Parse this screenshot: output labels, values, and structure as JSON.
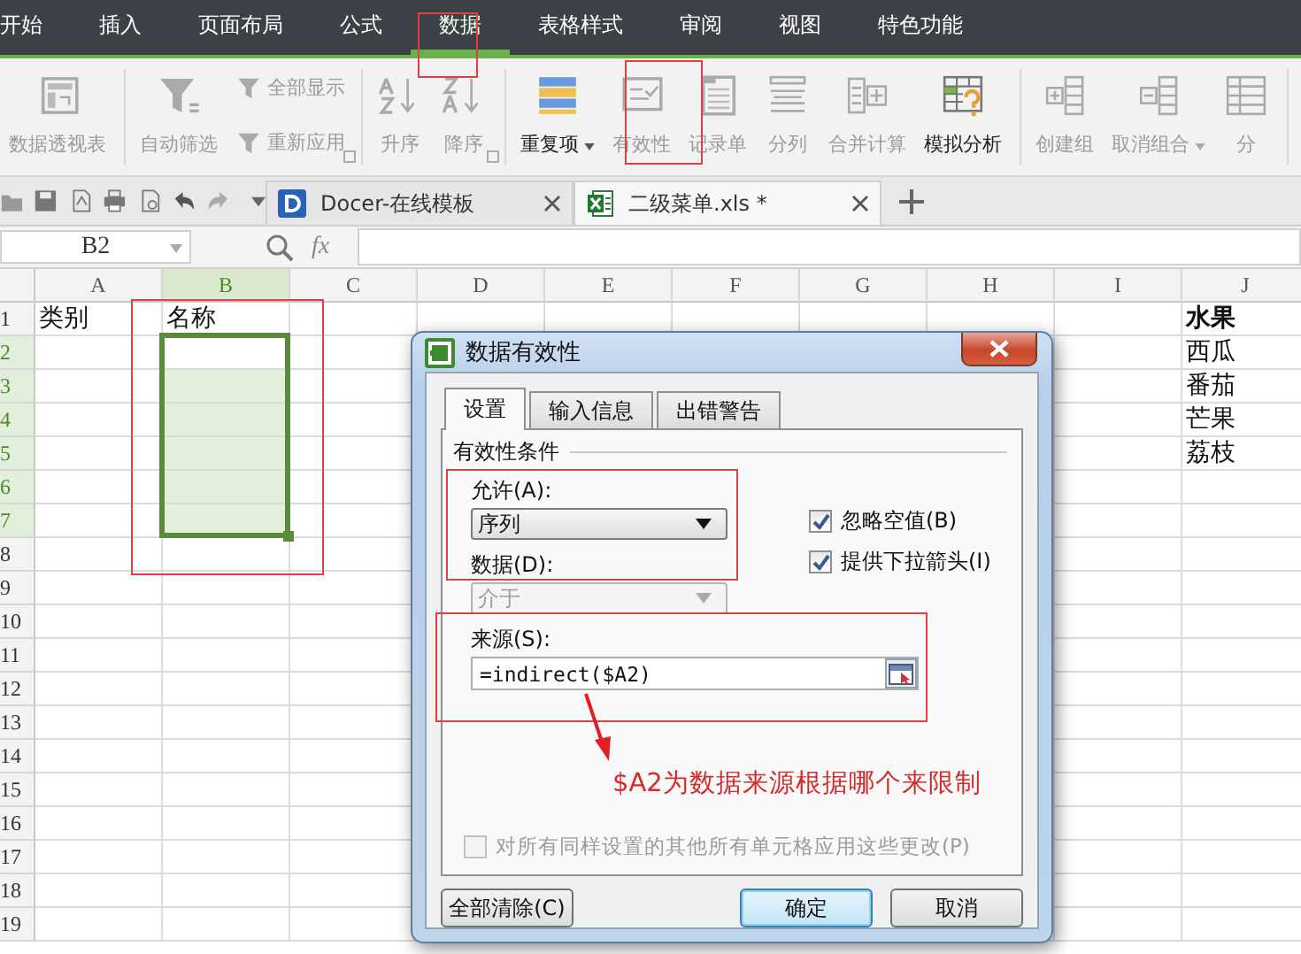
{
  "menu_tabs": [
    {
      "label": "开始",
      "selected": false
    },
    {
      "label": "插入",
      "selected": false
    },
    {
      "label": "页面布局",
      "selected": false
    },
    {
      "label": "公式",
      "selected": false
    },
    {
      "label": "数据",
      "selected": true
    },
    {
      "label": "表格样式",
      "selected": false
    },
    {
      "label": "审阅",
      "selected": false
    },
    {
      "label": "视图",
      "selected": false
    },
    {
      "label": "特色功能",
      "selected": false
    }
  ],
  "ribbon_groups": [
    {
      "launcher": false,
      "items": [
        {
          "kind": "large",
          "label": "数据透视表",
          "disabled": true,
          "dropdown": false
        }
      ]
    },
    {
      "launcher": true,
      "items": [
        {
          "kind": "large",
          "label": "自动筛选",
          "disabled": true,
          "dropdown": false
        },
        {
          "kind": "small",
          "label": "全部显示",
          "disabled": true,
          "dropdown": false
        },
        {
          "kind": "small",
          "label": "重新应用",
          "disabled": true,
          "dropdown": false
        }
      ]
    },
    {
      "launcher": true,
      "items": [
        {
          "kind": "large",
          "label": "升序",
          "disabled": true,
          "dropdown": false
        },
        {
          "kind": "large",
          "label": "降序",
          "disabled": true,
          "dropdown": false
        }
      ]
    },
    {
      "launcher": false,
      "items": [
        {
          "kind": "large",
          "label": "重复项",
          "disabled": false,
          "dropdown": true
        },
        {
          "kind": "large",
          "label": "有效性",
          "disabled": true,
          "dropdown": false
        },
        {
          "kind": "large",
          "label": "记录单",
          "disabled": true,
          "dropdown": false
        },
        {
          "kind": "large",
          "label": "分列",
          "disabled": true,
          "dropdown": false
        },
        {
          "kind": "large",
          "label": "合并计算",
          "disabled": true,
          "dropdown": false
        },
        {
          "kind": "large",
          "label": "模拟分析",
          "disabled": false,
          "dropdown": false
        }
      ]
    },
    {
      "launcher": false,
      "items": [
        {
          "kind": "large",
          "label": "创建组",
          "disabled": true,
          "dropdown": false
        },
        {
          "kind": "large",
          "label": "取消组合",
          "disabled": true,
          "dropdown": true
        },
        {
          "kind": "large",
          "label": "分",
          "disabled": true,
          "dropdown": false
        }
      ]
    }
  ],
  "doc_tabs": [
    {
      "kind": "docer",
      "label": "Docer-在线模板",
      "selected": false
    },
    {
      "kind": "sheet",
      "label": "二级菜单.xls *",
      "selected": true
    }
  ],
  "name_box": "B2",
  "formula_label": "fx",
  "sheet": {
    "columns": [
      {
        "label": "A",
        "selected": false
      },
      {
        "label": "B",
        "selected": true
      },
      {
        "label": "C",
        "selected": false
      },
      {
        "label": "D",
        "selected": false
      },
      {
        "label": "E",
        "selected": false
      },
      {
        "label": "F",
        "selected": false
      },
      {
        "label": "G",
        "selected": false
      },
      {
        "label": "H",
        "selected": false
      },
      {
        "label": "I",
        "selected": false
      },
      {
        "label": "J",
        "selected": false
      }
    ],
    "rows": [
      {
        "label": "1",
        "selected": false,
        "cells": {
          "A": {
            "text": "类别",
            "bold": false
          },
          "B": {
            "text": "名称",
            "bold": false
          },
          "J": {
            "text": "水果",
            "bold": true
          }
        }
      },
      {
        "label": "2",
        "selected": true,
        "cells": {
          "J": {
            "text": "西瓜",
            "bold": false
          }
        }
      },
      {
        "label": "3",
        "selected": true,
        "cells": {
          "J": {
            "text": "番茄",
            "bold": false
          }
        }
      },
      {
        "label": "4",
        "selected": true,
        "cells": {
          "J": {
            "text": "芒果",
            "bold": false
          }
        }
      },
      {
        "label": "5",
        "selected": true,
        "cells": {
          "J": {
            "text": "荔枝",
            "bold": false
          }
        }
      },
      {
        "label": "6",
        "selected": true
      },
      {
        "label": "7",
        "selected": true
      },
      {
        "label": "8",
        "selected": false
      },
      {
        "label": "9",
        "selected": false
      },
      {
        "label": "10",
        "selected": false
      },
      {
        "label": "11",
        "selected": false
      },
      {
        "label": "12",
        "selected": false
      },
      {
        "label": "13",
        "selected": false
      },
      {
        "label": "14",
        "selected": false
      },
      {
        "label": "15",
        "selected": false
      },
      {
        "label": "16",
        "selected": false
      },
      {
        "label": "17",
        "selected": false
      },
      {
        "label": "18",
        "selected": false
      },
      {
        "label": "19",
        "selected": false
      }
    ]
  },
  "dialog": {
    "title": "数据有效性",
    "tabs": [
      {
        "label": "设置",
        "selected": true
      },
      {
        "label": "输入信息",
        "selected": false
      },
      {
        "label": "出错警告",
        "selected": false
      }
    ],
    "group_title": "有效性条件",
    "allow": {
      "label": "允许(A):",
      "value": "序列",
      "disabled": false
    },
    "data": {
      "label": "数据(D):",
      "value": "介于",
      "disabled": true
    },
    "checkboxes": [
      {
        "label": "忽略空值(B)",
        "checked": true,
        "disabled": false
      },
      {
        "label": "提供下拉箭头(I)",
        "checked": true,
        "disabled": false
      }
    ],
    "source": {
      "label": "来源(S):",
      "value": "=indirect($A2)"
    },
    "annotation": "$A2为数据来源根据哪个来限制",
    "apply_all": {
      "label": "对所有同样设置的其他所有单元格应用这些更改(P)",
      "checked": false,
      "disabled": true
    },
    "buttons": [
      {
        "label": "全部清除(C)",
        "default": false
      },
      {
        "label": "确定",
        "default": true
      },
      {
        "label": "取消",
        "default": false
      }
    ]
  }
}
